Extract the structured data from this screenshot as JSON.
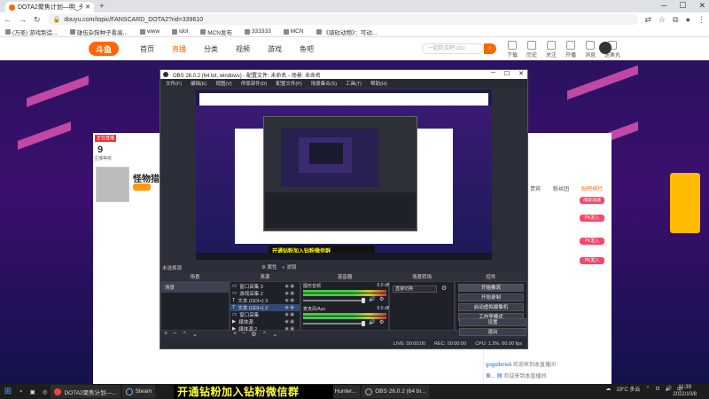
{
  "browser": {
    "tab_title": "DOTA2聚焦计划—明_头鱼直播间",
    "url": "douyu.com/topic/FANSCARD_DOTA2?rid=339610",
    "bookmarks": [
      "(万圣) 游戏制造...",
      "雄伍杂狗种子看高...",
      "www",
      "idol",
      "MCN发布",
      "333333",
      "MCN",
      "《骑砍动物》：可动..."
    ]
  },
  "site": {
    "logo": "斗鱼",
    "nav": [
      "首页",
      "直播",
      "分类",
      "视频",
      "游戏",
      "鱼吧"
    ],
    "search_placeholder": "一起吃瓜吧·zoo",
    "header_icons": [
      "下载",
      "历史",
      "关注",
      "开播",
      "消息",
      "送鱼丸"
    ]
  },
  "streamer": {
    "live_badge": "正在直播",
    "level": "9",
    "level_label": "主播等级",
    "name": "怪物猎人",
    "tag": "公告"
  },
  "chat": {
    "tabs": [
      "贵宾",
      "粉丝团",
      "贴吧排行"
    ],
    "messages": [
      {
        "user": "gogolbmeti",
        "text": "欢迎来到本直播间"
      },
      {
        "user": "鱼... 狮",
        "text": "欢迎来到本直播间"
      }
    ],
    "buttons": [
      "成就加速",
      "PK发入"
    ]
  },
  "obs": {
    "title": "OBS 26.0.2 (64 bit, windows) - 配置文件: 未命名 - 场景: 未命名",
    "menu": [
      "文件(F)",
      "编辑(E)",
      "视图(V)",
      "停靠部件(D)",
      "配置文件(P)",
      "场景集合(S)",
      "工具(T)",
      "帮助(H)"
    ],
    "banner": "开通钻粉加入钻粉微信群",
    "status_left": "未选择源",
    "props_btn": "属性",
    "filter_btn": "滤镜",
    "panel_headers": [
      "场景",
      "来源",
      "混音器",
      "场景转场",
      "控件"
    ],
    "scenes": [
      "场景"
    ],
    "sources": [
      "窗口采集 3",
      "游戏采集 2",
      "文本 (GDI+) 3",
      "文本 (GDI+) 2",
      "窗口采集",
      "媒体源",
      "媒体源 2"
    ],
    "mixer": [
      {
        "label": "图形音频",
        "db": "0.0 dB"
      },
      {
        "label": "麦克风/Aux",
        "db": "0.0 dB"
      }
    ],
    "transition": "直接切换",
    "controls": [
      "开始推流",
      "开始录制",
      "启动虚拟摄像机",
      "工作室模式",
      "设置",
      "退出"
    ],
    "status_bar": [
      "LIVE: 00:00:00",
      "REC: 00:00:00",
      "CPU: 1.2%, 60.00 fps"
    ]
  },
  "taskbar": {
    "apps": [
      "DOTA2聚焦计划—...",
      "Steam",
      "Monster Hunter...",
      "OBS 26.0.2 (64 bi..."
    ],
    "weather": "19°C 多云",
    "time": "11:39",
    "date": "2022/10/8"
  },
  "colors": {
    "accent": "#ff6600",
    "live": "#e33333",
    "banner_text": "#ffff33"
  }
}
